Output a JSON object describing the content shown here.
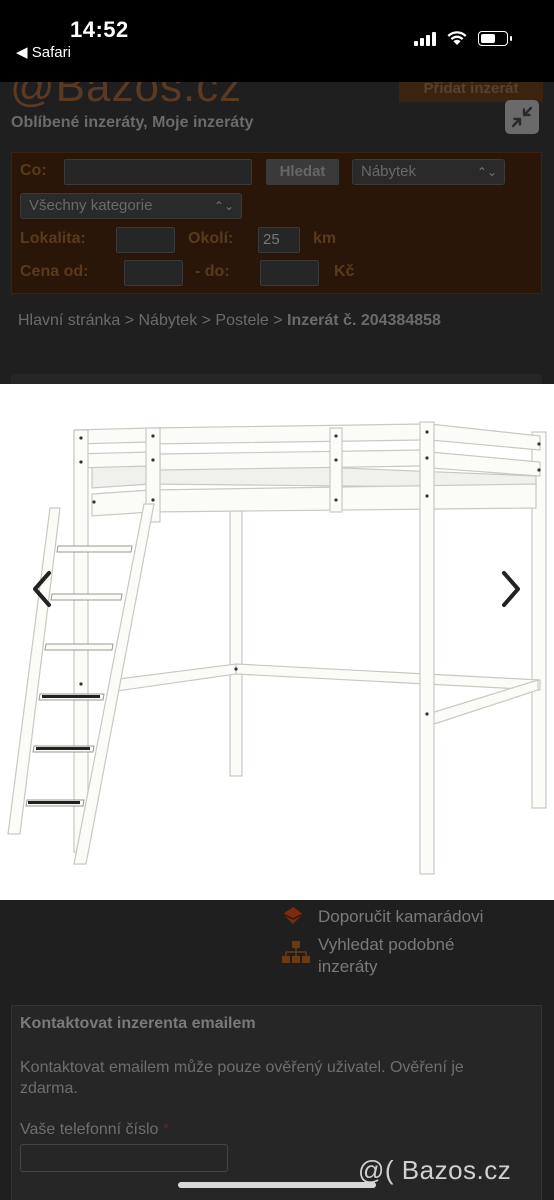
{
  "status_bar": {
    "time": "14:52",
    "back_app": "Safari"
  },
  "header": {
    "logo": "Bazos.cz",
    "post_ad": "Přidat inzerát",
    "fav_links": "Oblíbené inzeráty, Moje inzeráty"
  },
  "search": {
    "co_label": "Co:",
    "search_button": "Hledat",
    "category_selected": "Nábytek",
    "subcategory_selected": "Všechny kategorie",
    "location_label": "Lokalita:",
    "radius_label": "Okolí:",
    "radius_value": "25",
    "radius_unit": "km",
    "price_label": "Cena od:",
    "price_to": "- do:",
    "currency": "Kč"
  },
  "breadcrumb": {
    "path": "Hlavní stránka > Nábytek > Postele > ",
    "current": "Inzerát č. 204384858"
  },
  "side_links": {
    "recommend": "Doporučit kamarádovi",
    "similar": "Vyhledat podobné inzeráty"
  },
  "contact": {
    "title": "Kontaktovat inzerenta emailem",
    "text": "Kontaktovat emailem může pouze ověřený uživatel. Ověření je zdarma.",
    "phone_label": "Vaše telefonní číslo",
    "required_mark": "*"
  },
  "watermark": "@( Bazos.cz",
  "icons": {
    "prev": "chevron-left-icon",
    "next": "chevron-right-icon",
    "collapse": "collapse-icon"
  }
}
